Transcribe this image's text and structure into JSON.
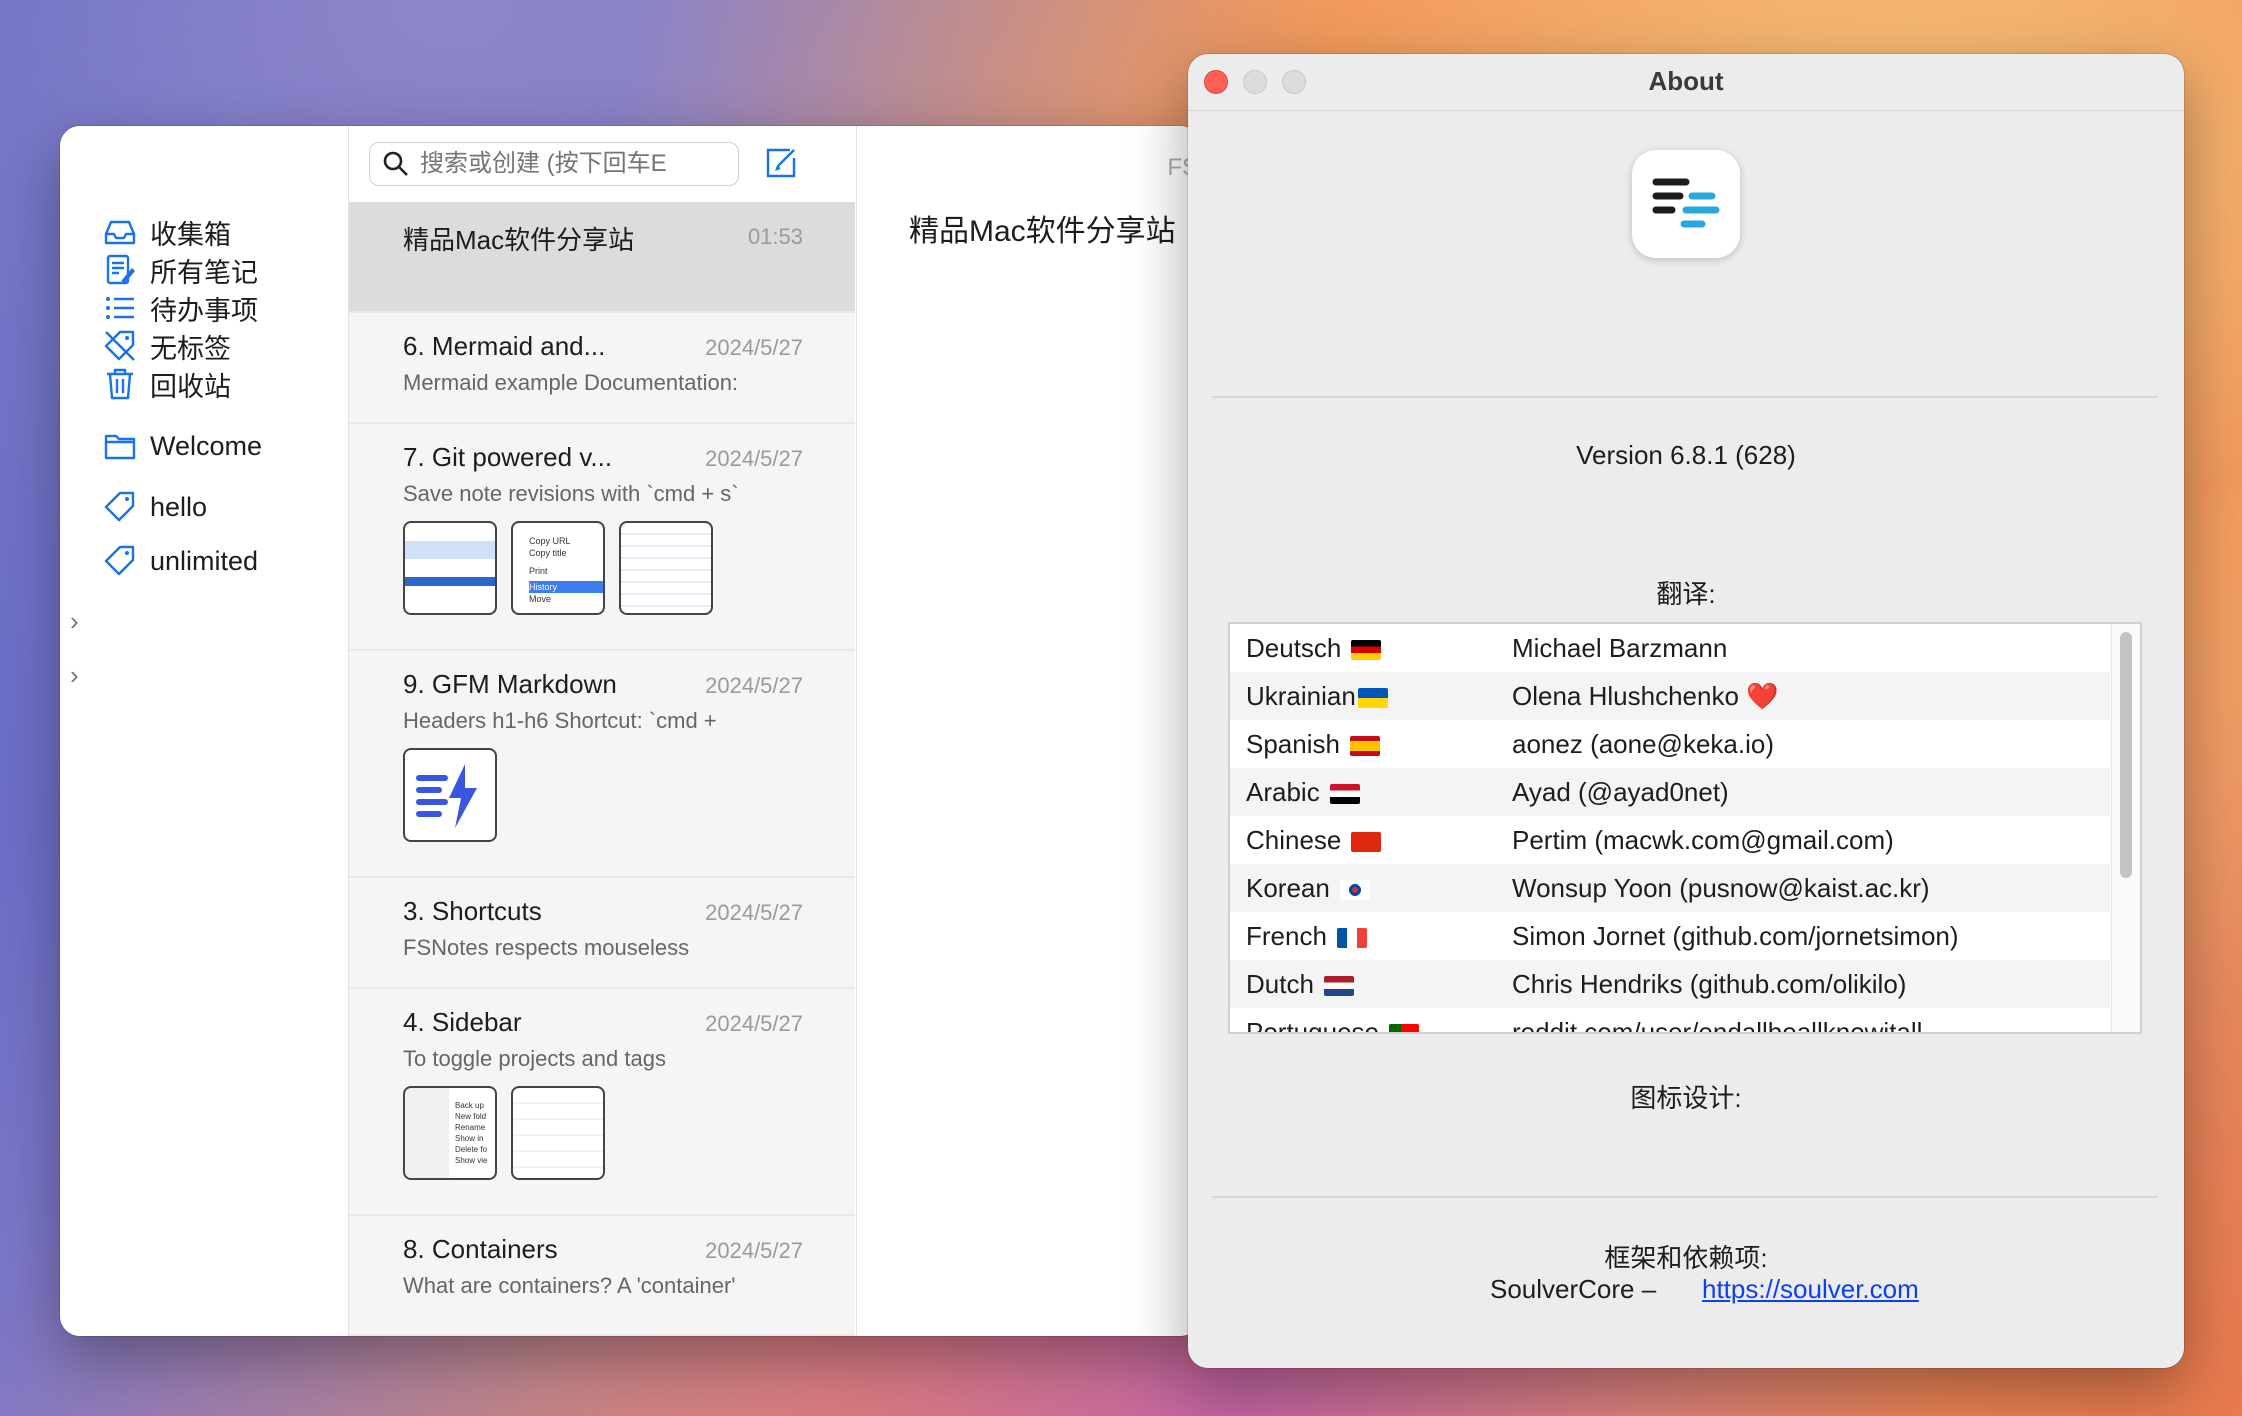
{
  "main_window": {
    "sidebar": {
      "items": [
        {
          "label": "收集箱",
          "icon": "inbox-icon"
        },
        {
          "label": "所有笔记",
          "icon": "notes-icon"
        },
        {
          "label": "待办事项",
          "icon": "list-icon"
        },
        {
          "label": "无标签",
          "icon": "untagged-icon"
        },
        {
          "label": "回收站",
          "icon": "trash-icon"
        }
      ],
      "folder": {
        "label": "Welcome",
        "icon": "folder-icon"
      },
      "tags": [
        {
          "label": "hello",
          "icon": "tag-icon"
        },
        {
          "label": "unlimited",
          "icon": "tag-icon"
        }
      ]
    },
    "search": {
      "placeholder": "搜索或创建 (按下回车E"
    },
    "notes": [
      {
        "title": "精品Mac软件分享站",
        "date": "01:53",
        "preview": ""
      },
      {
        "title": "6. Mermaid and...",
        "date": "2024/5/27",
        "preview": "Mermaid example Documentation:"
      },
      {
        "title": "7. Git powered v...",
        "date": "2024/5/27",
        "preview": "Save note revisions with `cmd + s`"
      },
      {
        "title": "9. GFM Markdown",
        "date": "2024/5/27",
        "preview": "Headers h1-h6 Shortcut: `cmd +"
      },
      {
        "title": "3. Shortcuts",
        "date": "2024/5/27",
        "preview": "FSNotes respects mouseless"
      },
      {
        "title": "4. Sidebar",
        "date": "2024/5/27",
        "preview": "To toggle projects and tags"
      },
      {
        "title": "8. Containers",
        "date": "2024/5/27",
        "preview": "What are containers? A 'container'"
      }
    ],
    "thumb_text": {
      "menu1": [
        "Copy URL",
        "Copy title",
        "Print",
        "History",
        "Move"
      ],
      "menu2": [
        "Back up",
        "New fold",
        "Rename",
        "Show in",
        "Delete fo",
        "Show vie"
      ]
    },
    "editor": {
      "title": "精品Mac软件分享站",
      "fs_label": "FS"
    }
  },
  "about_window": {
    "title": "About",
    "version": "Version 6.8.1 (628)",
    "translations_heading": "翻译:",
    "translators": [
      {
        "lang": "Deutsch",
        "flag": "de",
        "name": "Michael Barzmann"
      },
      {
        "lang": "Ukrainian",
        "flag": "ua",
        "name": "Olena Hlushchenko",
        "heart": "❤️"
      },
      {
        "lang": "Spanish",
        "flag": "es",
        "name": "aonez (aone@keka.io)"
      },
      {
        "lang": "Arabic",
        "flag": "iq",
        "name": "Ayad (@ayad0net)"
      },
      {
        "lang": "Chinese",
        "flag": "cn",
        "name": "Pertim (macwk.com@gmail.com)"
      },
      {
        "lang": "Korean",
        "flag": "kr",
        "name": "Wonsup Yoon (pusnow@kaist.ac.kr)"
      },
      {
        "lang": "French",
        "flag": "fr",
        "name": "Simon Jornet (github.com/jornetsimon)"
      },
      {
        "lang": "Dutch",
        "flag": "nl",
        "name": "Chris Hendriks (github.com/olikilo)"
      },
      {
        "lang": "Portuguese",
        "flag": "pt",
        "name": "reddit.com/user/endallbeallknowitall"
      }
    ],
    "icon_design_heading": "图标设计:",
    "frameworks_heading": "框架和依赖项:",
    "dependency": {
      "name": "SoulverCore –",
      "link": "https://soulver.com"
    }
  }
}
